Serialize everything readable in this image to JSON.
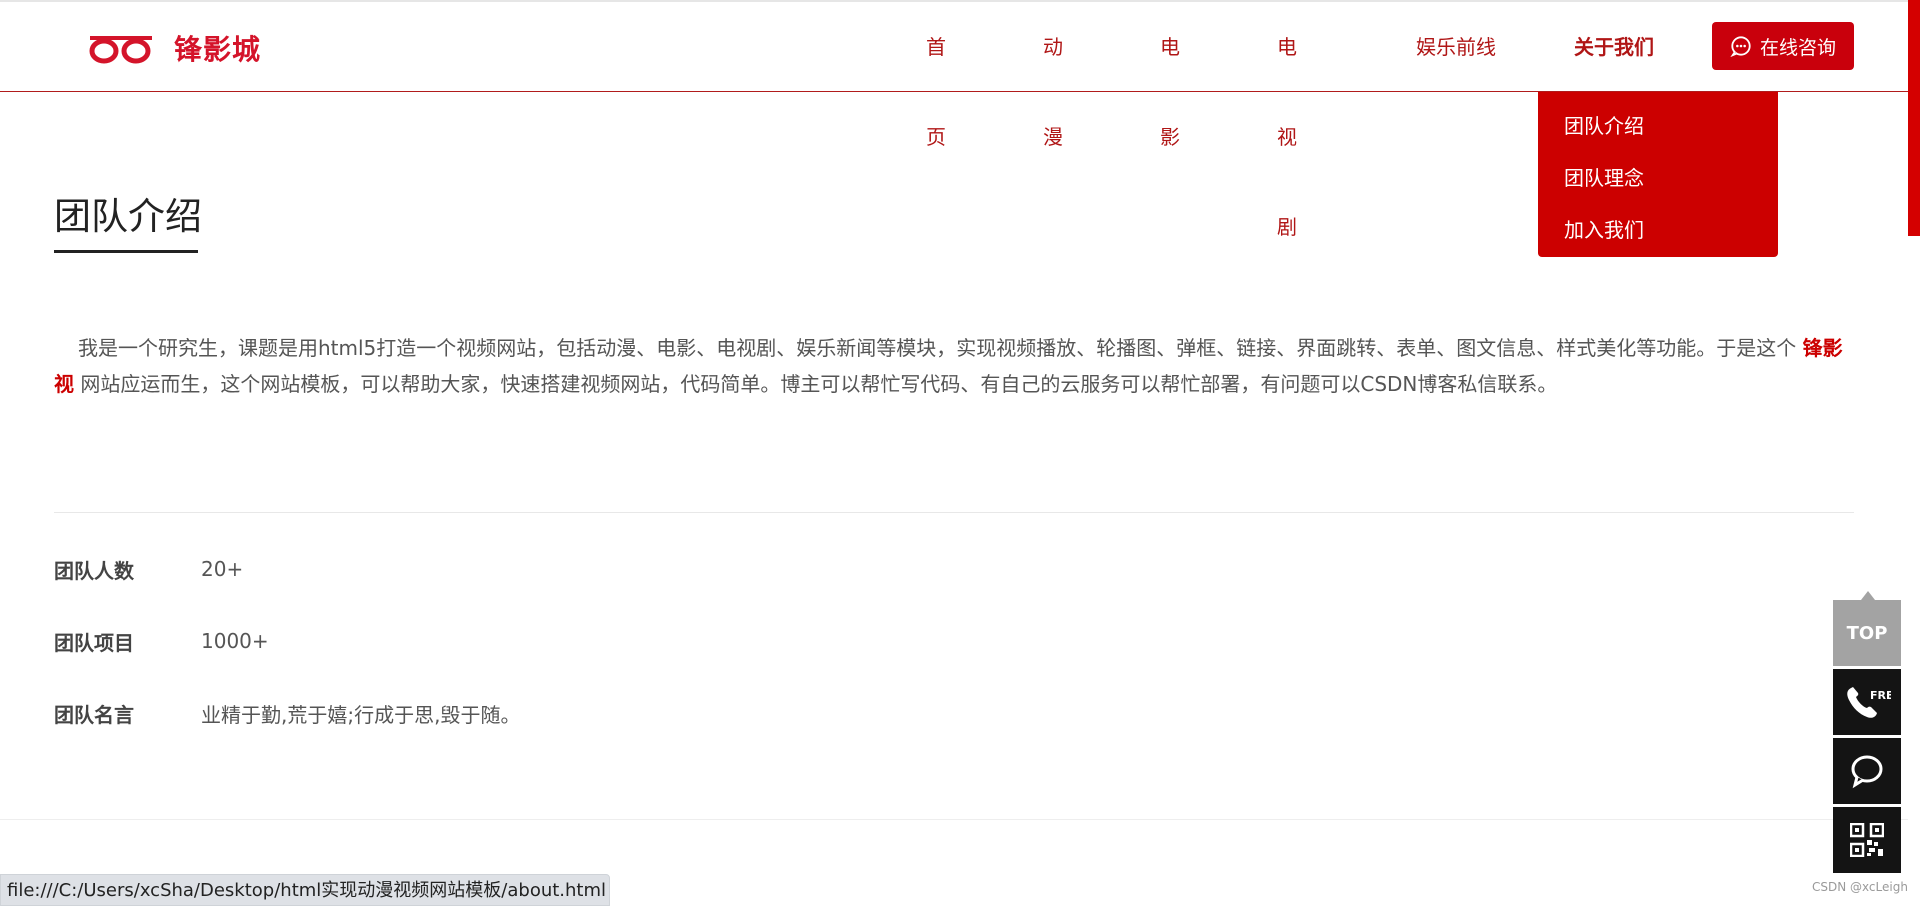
{
  "header": {
    "logo_text": "锋影城",
    "nav": [
      {
        "label": "首页"
      },
      {
        "label": "动漫"
      },
      {
        "label": "电影"
      },
      {
        "label": "电视剧"
      },
      {
        "label": "娱乐前线"
      },
      {
        "label": "关于我们",
        "active": true
      }
    ],
    "consult_label": "在线咨询",
    "accent_color": "#cc0000"
  },
  "dropdown": {
    "items": [
      {
        "label": "团队介绍"
      },
      {
        "label": "团队理念"
      },
      {
        "label": "加入我们"
      }
    ]
  },
  "main": {
    "title": "团队介绍",
    "intro_part1": "我是一个研究生，课题是用html5打造一个视频网站，包括动漫、电影、电视剧、娱乐新闻等模块，实现视频播放、轮播图、弹框、链接、界面跳转、表单、图文信息、样式美化等功能。于是这个",
    "intro_brand": "锋影视",
    "intro_part2": "网站应运而生，这个网站模板，可以帮助大家，快速搭建视频网站，代码简单。博主可以帮忙写代码、有自己的云服务可以帮忙部署，有问题可以CSDN博客私信联系。",
    "stats": [
      {
        "label": "团队人数",
        "value": "20+"
      },
      {
        "label": "团队项目",
        "value": "1000+"
      },
      {
        "label": "团队名言",
        "value": "业精于勤,荒于嬉;行成于思,毁于随。"
      }
    ]
  },
  "float_bar": {
    "top_label": "TOP",
    "free_label": "FREE",
    "icons": [
      "phone-icon",
      "chat-icon",
      "qrcode-icon"
    ]
  },
  "statusbar": {
    "url": "file:///C:/Users/xcSha/Desktop/html实现动漫视频网站模板/about.html"
  },
  "watermark": "CSDN @xcLeigh"
}
